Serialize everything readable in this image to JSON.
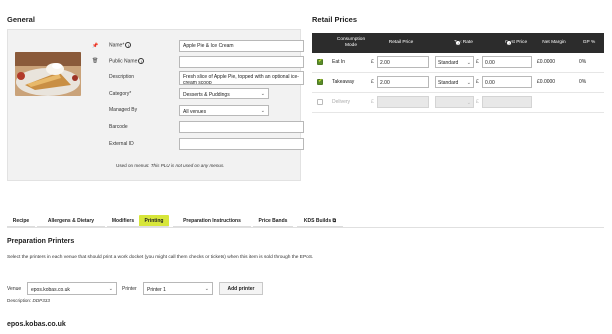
{
  "general": {
    "title": "General",
    "fields": {
      "name_label": "Name*",
      "name_value": "Apple Pie & Ice Cream",
      "public_name_label": "Public Name",
      "public_name_value": "",
      "description_label": "Description",
      "description_value": "Fresh slice of Apple Pie, topped with an optional ice-cream scoop",
      "category_label": "Category*",
      "category_value": "Desserts & Puddings",
      "managed_by_label": "Managed By",
      "managed_by_value": "All venues",
      "barcode_label": "Barcode",
      "barcode_value": "",
      "external_id_label": "External ID",
      "external_id_value": ""
    },
    "used_on_prefix": "Used on menus:",
    "used_on_text": "This PLU is not used on any menus."
  },
  "retail": {
    "title": "Retail Prices",
    "headers": {
      "mode": "Consumption Mode",
      "retail_price": "Retail Price",
      "tax_rate": "Tax Rate",
      "cost_price": "Cost Price",
      "net_margin": "Net Margin",
      "gp": "GP %"
    },
    "currency_symbol": "£",
    "rows": [
      {
        "checked": true,
        "mode": "Eat In",
        "retail_price": "2.00",
        "tax_rate": "Standard",
        "cost_price": "0.00",
        "net_margin": "£0.0000",
        "gp": "0%"
      },
      {
        "checked": true,
        "mode": "Takeaway",
        "retail_price": "2.00",
        "tax_rate": "Standard",
        "cost_price": "0.00",
        "net_margin": "£0.0000",
        "gp": "0%"
      },
      {
        "checked": false,
        "mode": "Delivery",
        "retail_price": "",
        "tax_rate": "",
        "cost_price": "",
        "net_margin": "",
        "gp": ""
      }
    ],
    "colors": {
      "header_bg": "#2c2c2c",
      "check_green": "#5b8c2a"
    }
  },
  "tabs": {
    "items": [
      "Recipe",
      "Allergens & Dietary",
      "Modifiers",
      "Printing",
      "Preparation Instructions",
      "Price Bands",
      "KDS Builds"
    ],
    "active": "Printing",
    "active_color": "#d7e63a"
  },
  "printing": {
    "heading": "Preparation Printers",
    "intro": "Select the printers in each venue that should print a work docket (you might call them checks or tickets) when this item is sold through the EPoS.",
    "venue_label": "Venue",
    "venue_value": "epos.kobas.co.uk",
    "printer_label": "Printer",
    "printer_value": "Printer 1",
    "add_button": "Add printer",
    "description_label": "Description:",
    "description_value": "DDP333",
    "venue_heading": "epos.kobas.co.uk"
  }
}
